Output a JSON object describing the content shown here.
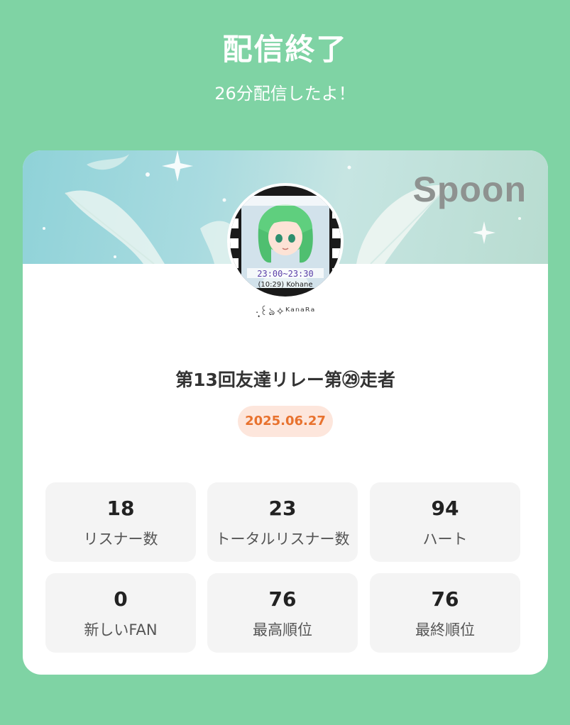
{
  "header": {
    "title": "配信終了",
    "subtitle": "26分配信したよ！"
  },
  "banner": {
    "brand": "Spoon"
  },
  "profile": {
    "username": "·̩͙꒰ঌ✧ᴷᵃⁿᵃᴿᵃ",
    "avatar_text_1": "23:00~23:30",
    "avatar_text_2": "(10:29) Kohane"
  },
  "stream": {
    "title": "第13回友達リレー第㉙走者",
    "date": "2025.06.27"
  },
  "stats": [
    {
      "value": "18",
      "label": "リスナー数"
    },
    {
      "value": "23",
      "label": "トータルリスナー数"
    },
    {
      "value": "94",
      "label": "ハート"
    },
    {
      "value": "0",
      "label": "新しいFAN"
    },
    {
      "value": "76",
      "label": "最高順位"
    },
    {
      "value": "76",
      "label": "最終順位"
    }
  ],
  "colors": {
    "background": "#7fd3a4",
    "date_badge_bg": "#fde6dc",
    "date_badge_text": "#e8722e",
    "stat_bg": "#f4f4f4"
  }
}
